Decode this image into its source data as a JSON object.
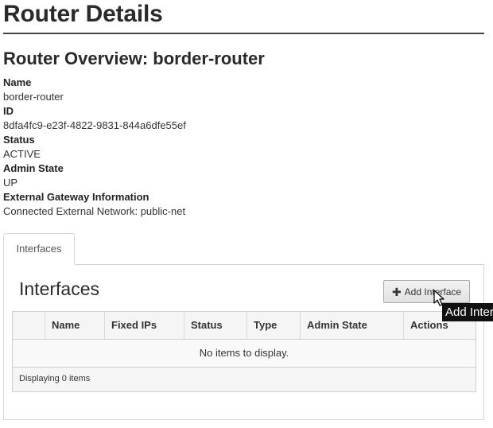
{
  "page": {
    "title": "Router Details"
  },
  "overview": {
    "title": "Router Overview: border-router",
    "fields": [
      {
        "label": "Name",
        "value": "border-router"
      },
      {
        "label": "ID",
        "value": "8dfa4fc9-e23f-4822-9831-844a6dfe55ef"
      },
      {
        "label": "Status",
        "value": "ACTIVE"
      },
      {
        "label": "Admin State",
        "value": "UP"
      },
      {
        "label": "External Gateway Information",
        "value": "Connected External Network: public-net"
      }
    ]
  },
  "tabs": [
    {
      "label": "Interfaces",
      "active": true
    }
  ],
  "interfaces": {
    "title": "Interfaces",
    "add_button": {
      "icon": "plus-icon",
      "label": "Add Interface"
    },
    "columns": [
      "",
      "Name",
      "Fixed IPs",
      "Status",
      "Type",
      "Admin State",
      "Actions"
    ],
    "empty_message": "No items to display.",
    "footer": "Displaying 0 items"
  },
  "tooltip": {
    "text": "Add Interface"
  }
}
